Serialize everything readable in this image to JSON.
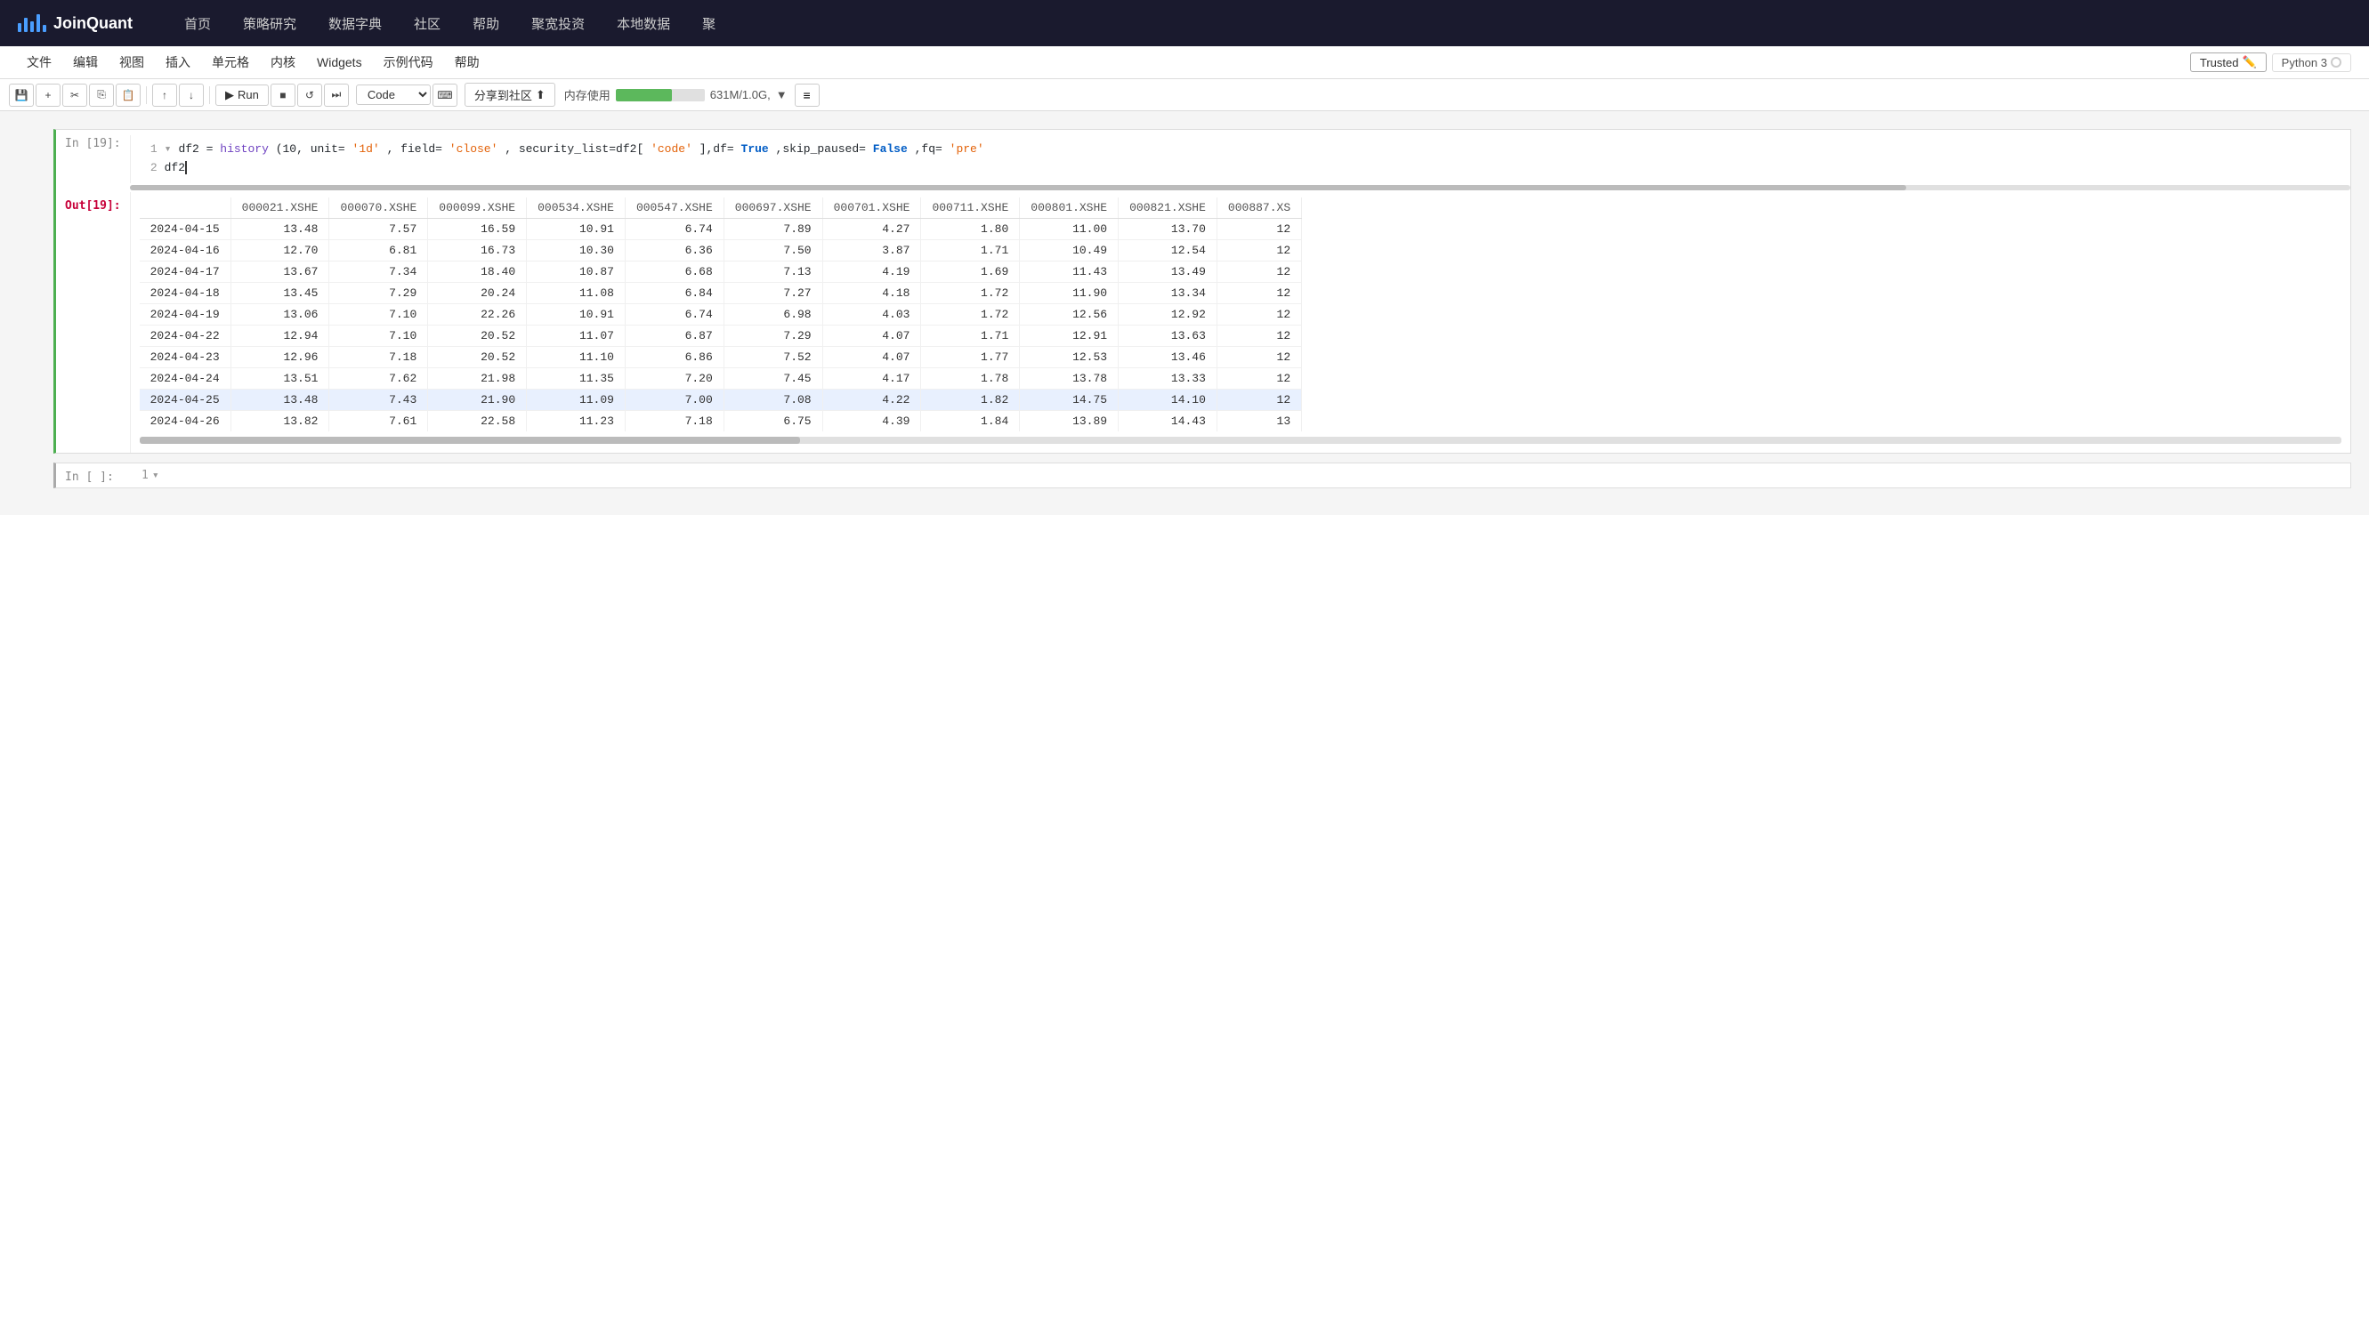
{
  "brand": {
    "name": "JoinQuant"
  },
  "nav": {
    "items": [
      "首页",
      "策略研究",
      "数据字典",
      "社区",
      "帮助",
      "聚宽投资",
      "本地数据",
      "聚"
    ]
  },
  "menu_bar": {
    "items": [
      "文件",
      "编辑",
      "视图",
      "插入",
      "单元格",
      "内核",
      "Widgets",
      "示例代码",
      "帮助"
    ],
    "trusted": "Trusted",
    "python": "Python 3"
  },
  "toolbar": {
    "run_label": "Run",
    "kernel_option": "Code",
    "share_label": "分享到社区",
    "mem_label": "内存使用",
    "mem_value": "631M/1.0G,"
  },
  "cell_in": {
    "label": "In [19]:",
    "line1": "df2 = history(10, unit='1d', field='close', security_list=df2['code'],df=True,skip_paused=False,fq='pre'",
    "line2": "df2",
    "line1_num": "1",
    "line2_num": "2"
  },
  "cell_out": {
    "label": "Out[19]:",
    "columns": [
      "000021.XSHE",
      "000070.XSHE",
      "000099.XSHE",
      "000534.XSHE",
      "000547.XSHE",
      "000697.XSHE",
      "000701.XSHE",
      "000711.XSHE",
      "000801.XSHE",
      "000821.XSHE",
      "000887.XS"
    ],
    "rows": [
      {
        "date": "2024-04-15",
        "vals": [
          "13.48",
          "7.57",
          "16.59",
          "10.91",
          "6.74",
          "7.89",
          "4.27",
          "1.80",
          "11.00",
          "13.70",
          "12"
        ],
        "highlight": false
      },
      {
        "date": "2024-04-16",
        "vals": [
          "12.70",
          "6.81",
          "16.73",
          "10.30",
          "6.36",
          "7.50",
          "3.87",
          "1.71",
          "10.49",
          "12.54",
          "12"
        ],
        "highlight": false
      },
      {
        "date": "2024-04-17",
        "vals": [
          "13.67",
          "7.34",
          "18.40",
          "10.87",
          "6.68",
          "7.13",
          "4.19",
          "1.69",
          "11.43",
          "13.49",
          "12"
        ],
        "highlight": false
      },
      {
        "date": "2024-04-18",
        "vals": [
          "13.45",
          "7.29",
          "20.24",
          "11.08",
          "6.84",
          "7.27",
          "4.18",
          "1.72",
          "11.90",
          "13.34",
          "12"
        ],
        "highlight": false
      },
      {
        "date": "2024-04-19",
        "vals": [
          "13.06",
          "7.10",
          "22.26",
          "10.91",
          "6.74",
          "6.98",
          "4.03",
          "1.72",
          "12.56",
          "12.92",
          "12"
        ],
        "highlight": false
      },
      {
        "date": "2024-04-22",
        "vals": [
          "12.94",
          "7.10",
          "20.52",
          "11.07",
          "6.87",
          "7.29",
          "4.07",
          "1.71",
          "12.91",
          "13.63",
          "12"
        ],
        "highlight": false
      },
      {
        "date": "2024-04-23",
        "vals": [
          "12.96",
          "7.18",
          "20.52",
          "11.10",
          "6.86",
          "7.52",
          "4.07",
          "1.77",
          "12.53",
          "13.46",
          "12"
        ],
        "highlight": false
      },
      {
        "date": "2024-04-24",
        "vals": [
          "13.51",
          "7.62",
          "21.98",
          "11.35",
          "7.20",
          "7.45",
          "4.17",
          "1.78",
          "13.78",
          "13.33",
          "12"
        ],
        "highlight": false
      },
      {
        "date": "2024-04-25",
        "vals": [
          "13.48",
          "7.43",
          "21.90",
          "11.09",
          "7.00",
          "7.08",
          "4.22",
          "1.82",
          "14.75",
          "14.10",
          "12"
        ],
        "highlight": true
      },
      {
        "date": "2024-04-26",
        "vals": [
          "13.82",
          "7.61",
          "22.58",
          "11.23",
          "7.18",
          "6.75",
          "4.39",
          "1.84",
          "13.89",
          "14.43",
          "13"
        ],
        "highlight": false
      }
    ]
  },
  "empty_cell": {
    "label": "In [ ]:",
    "line_num": "1"
  }
}
